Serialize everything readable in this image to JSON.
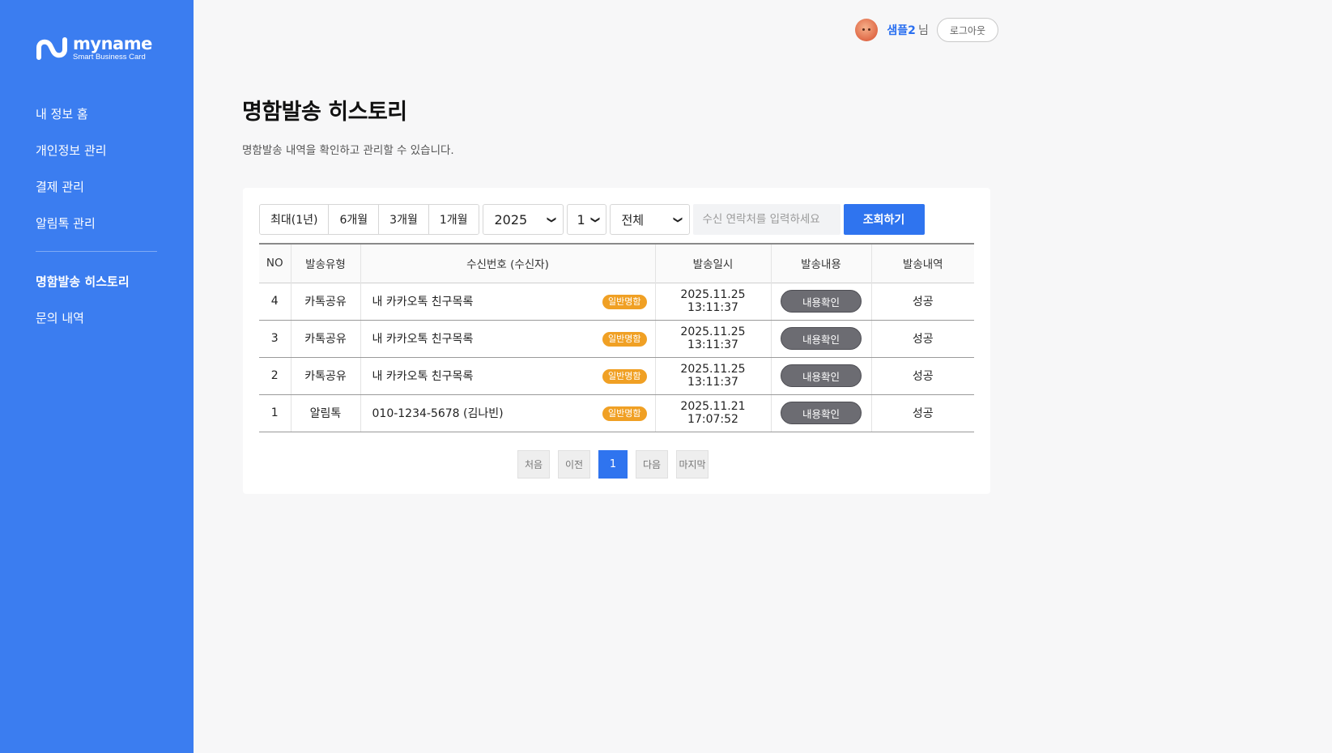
{
  "brand": {
    "name": "myname",
    "tagline": "Smart Business Card"
  },
  "sidebar": {
    "items": [
      {
        "label": "내 정보 홈"
      },
      {
        "label": "개인정보 관리"
      },
      {
        "label": "결제 관리"
      },
      {
        "label": "알림톡 관리"
      },
      {
        "label": "명함발송 히스토리",
        "active": true
      },
      {
        "label": "문의 내역"
      }
    ]
  },
  "user": {
    "name": "샘플2",
    "suffix": "님",
    "logout_label": "로그아웃"
  },
  "page": {
    "title": "명함발송 히스토리",
    "description": "명함발송 내역을 확인하고 관리할 수 있습니다."
  },
  "filters": {
    "periods": [
      "최대(1년)",
      "6개월",
      "3개월",
      "1개월"
    ],
    "year": "2025",
    "month": "1",
    "type": "전체",
    "search_placeholder": "수신 연락처를 입력하세요",
    "search_button": "조회하기"
  },
  "table": {
    "headers": {
      "no": "NO",
      "type": "발송유형",
      "receiver": "수신번호 (수신자)",
      "date": "발송일시",
      "content": "발송내용",
      "result": "발송내역"
    },
    "rows": [
      {
        "no": "4",
        "type": "카톡공유",
        "receiver": "내 카카오톡 친구목록",
        "tag": "일반명함",
        "date": "2025.11.25 13:11:37",
        "content": "내용확인",
        "result": "성공"
      },
      {
        "no": "3",
        "type": "카톡공유",
        "receiver": "내 카카오톡 친구목록",
        "tag": "일반명함",
        "date": "2025.11.25 13:11:37",
        "content": "내용확인",
        "result": "성공"
      },
      {
        "no": "2",
        "type": "카톡공유",
        "receiver": "내 카카오톡 친구목록",
        "tag": "일반명함",
        "date": "2025.11.25 13:11:37",
        "content": "내용확인",
        "result": "성공"
      },
      {
        "no": "1",
        "type": "알림톡",
        "receiver": "010-1234-5678 (김나빈)",
        "tag": "일반명함",
        "date": "2025.11.21 17:07:52",
        "content": "내용확인",
        "result": "성공"
      }
    ]
  },
  "pagination": {
    "first": "처음",
    "prev": "이전",
    "current": "1",
    "next": "다음",
    "last": "마지막"
  },
  "colors": {
    "sidebar_bg": "#3b7df0",
    "primary": "#2f74ef",
    "tag": "#f0a024",
    "view_button": "#6c6c72"
  }
}
